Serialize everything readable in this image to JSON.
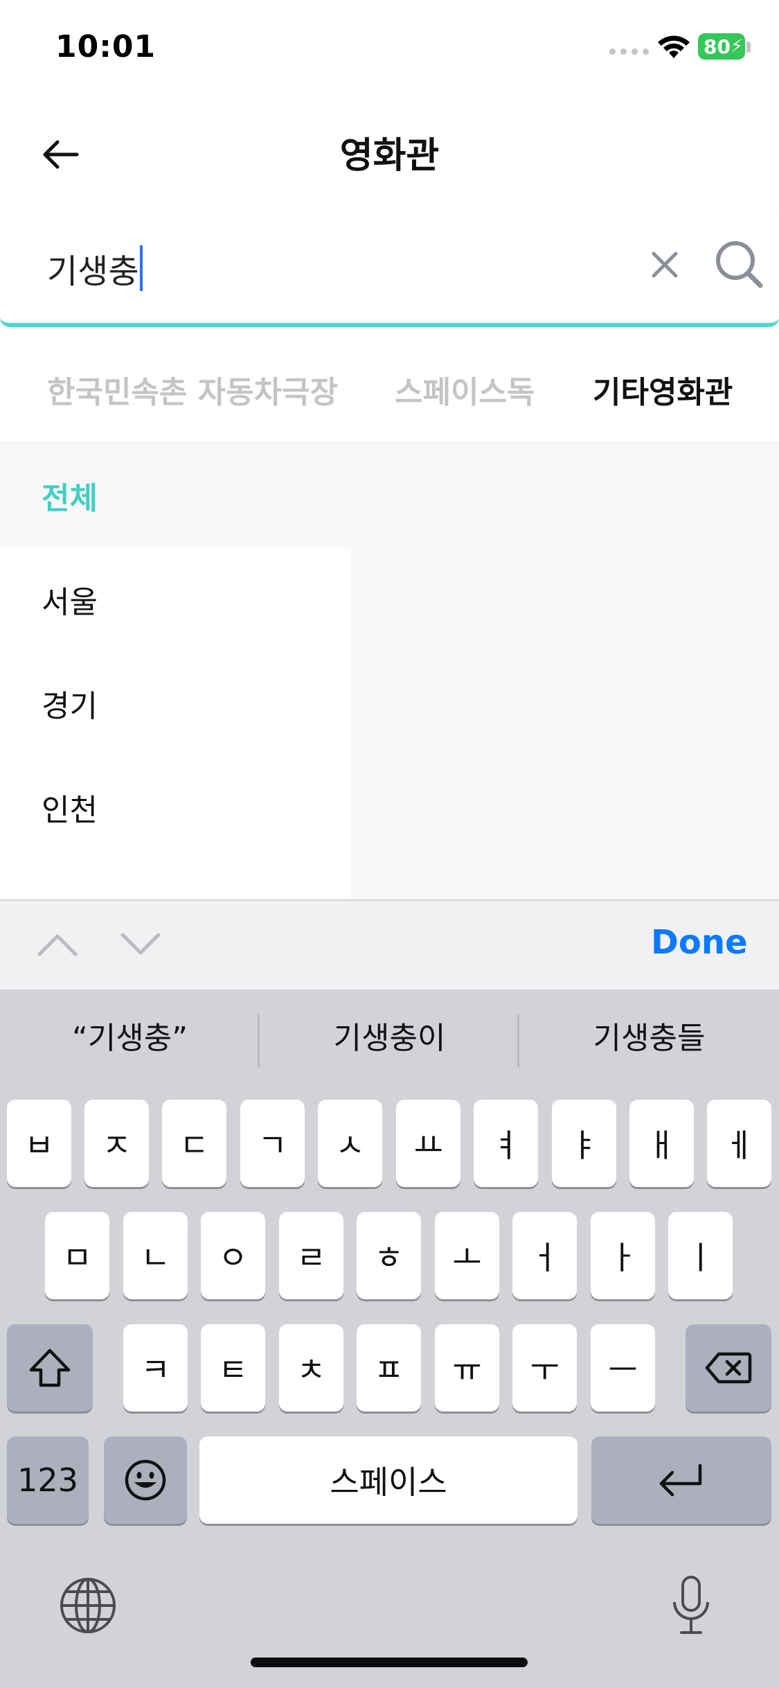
{
  "status_bar": {
    "time": "10:01",
    "battery": "80"
  },
  "header": {
    "title": "영화관"
  },
  "search": {
    "query": "기생충"
  },
  "tabs": [
    {
      "label": "한국민속촌 자동차극장",
      "active": false
    },
    {
      "label": "스페이스독",
      "active": false
    },
    {
      "label": "기타영화관",
      "active": true
    }
  ],
  "regions": [
    {
      "label": "전체",
      "selected": true
    },
    {
      "label": "서울",
      "selected": false
    },
    {
      "label": "경기",
      "selected": false
    },
    {
      "label": "인천",
      "selected": false
    }
  ],
  "accessory": {
    "done_label": "Done"
  },
  "keyboard": {
    "suggestions": [
      "“기생충”",
      "기생충이",
      "기생충들"
    ],
    "row1": [
      "ㅂ",
      "ㅈ",
      "ㄷ",
      "ㄱ",
      "ㅅ",
      "ㅛ",
      "ㅕ",
      "ㅑ",
      "ㅐ",
      "ㅔ"
    ],
    "row2": [
      "ㅁ",
      "ㄴ",
      "ㅇ",
      "ㄹ",
      "ㅎ",
      "ㅗ",
      "ㅓ",
      "ㅏ",
      "ㅣ"
    ],
    "row3": [
      "ㅋ",
      "ㅌ",
      "ㅊ",
      "ㅍ",
      "ㅠ",
      "ㅜ",
      "ㅡ"
    ],
    "numbers_label": "123",
    "space_label": "스페이스"
  },
  "colors": {
    "accent": "#40cfc4",
    "search_underline": "#4fd6cc",
    "done_blue": "#0a7aff",
    "battery_green": "#34c759"
  }
}
